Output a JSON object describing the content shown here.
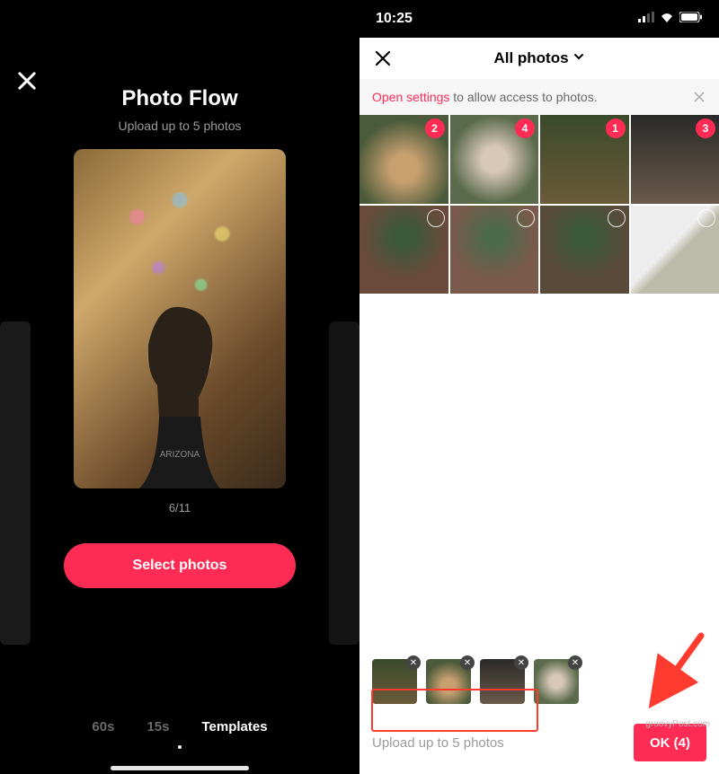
{
  "left": {
    "title": "Photo Flow",
    "subtitle": "Upload up to 5 photos",
    "counter": "6/11",
    "select_button": "Select photos",
    "tabs": [
      "60s",
      "15s",
      "Templates"
    ],
    "active_tab_index": 2
  },
  "right": {
    "status": {
      "time": "10:25"
    },
    "header": {
      "title": "All photos"
    },
    "banner": {
      "link_text": "Open settings",
      "rest_text": " to allow access to photos."
    },
    "grid": [
      {
        "selected": true,
        "order": 2,
        "bg": "bg-dog1"
      },
      {
        "selected": true,
        "order": 4,
        "bg": "bg-dog2"
      },
      {
        "selected": true,
        "order": 1,
        "bg": "bg-dog3"
      },
      {
        "selected": true,
        "order": 3,
        "bg": "bg-dog4"
      },
      {
        "selected": false,
        "bg": "bg-tree1"
      },
      {
        "selected": false,
        "bg": "bg-tree2"
      },
      {
        "selected": false,
        "bg": "bg-tree3"
      },
      {
        "selected": false,
        "bg": "bg-desk"
      }
    ],
    "selected_strip": [
      {
        "bg": "bg-dog3"
      },
      {
        "bg": "bg-dog1"
      },
      {
        "bg": "bg-dog4"
      },
      {
        "bg": "bg-dog2"
      }
    ],
    "upload_hint": "Upload up to 5 photos",
    "ok_button": "OK (4)",
    "watermark": "groovyPost.com"
  }
}
